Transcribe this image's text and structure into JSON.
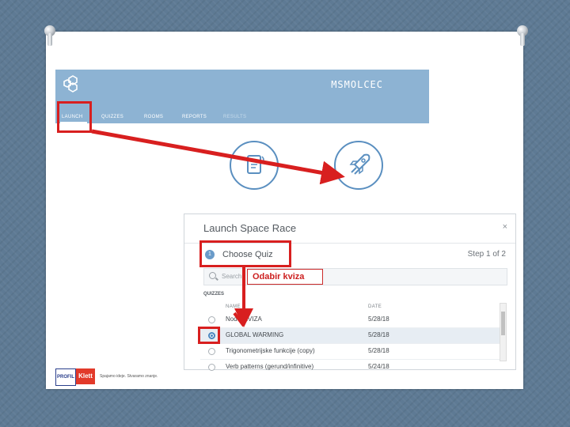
{
  "app": {
    "username": "MSMOLCEC",
    "tabs": [
      "LAUNCH",
      "QUIZZES",
      "ROOMS",
      "REPORTS",
      "RESULTS"
    ],
    "active_tab": "LAUNCH"
  },
  "modal": {
    "title": "Launch Space Race",
    "close_glyph": "×",
    "step_number": "1",
    "step_label": "Choose Quiz",
    "step_count": "Step 1 of 2",
    "search_placeholder": "Search",
    "section_label": "QUIZZES",
    "columns": [
      "NAME",
      "DATE"
    ],
    "rows": [
      {
        "name": "Nodvi KVIZA",
        "date": "5/28/18",
        "selected": false
      },
      {
        "name": "GLOBAL WARMING",
        "date": "5/28/18",
        "selected": true
      },
      {
        "name": "Trigonometrijske funkcije (copy)",
        "date": "5/28/18",
        "selected": false
      },
      {
        "name": "Verb patterns (gerund/infinitive)",
        "date": "5/24/18",
        "selected": false
      }
    ]
  },
  "annotation": {
    "tooltip": "Odabir kviza",
    "color": "#d81f1f"
  },
  "brand": {
    "profil": "PROFIL",
    "klett": "Klett",
    "slogan": "Spajamo ideje. Stvaramo znanje."
  },
  "colors": {
    "appbar": "#8db3d3",
    "accent": "#4a86c0",
    "highlight": "#d81f1f"
  }
}
